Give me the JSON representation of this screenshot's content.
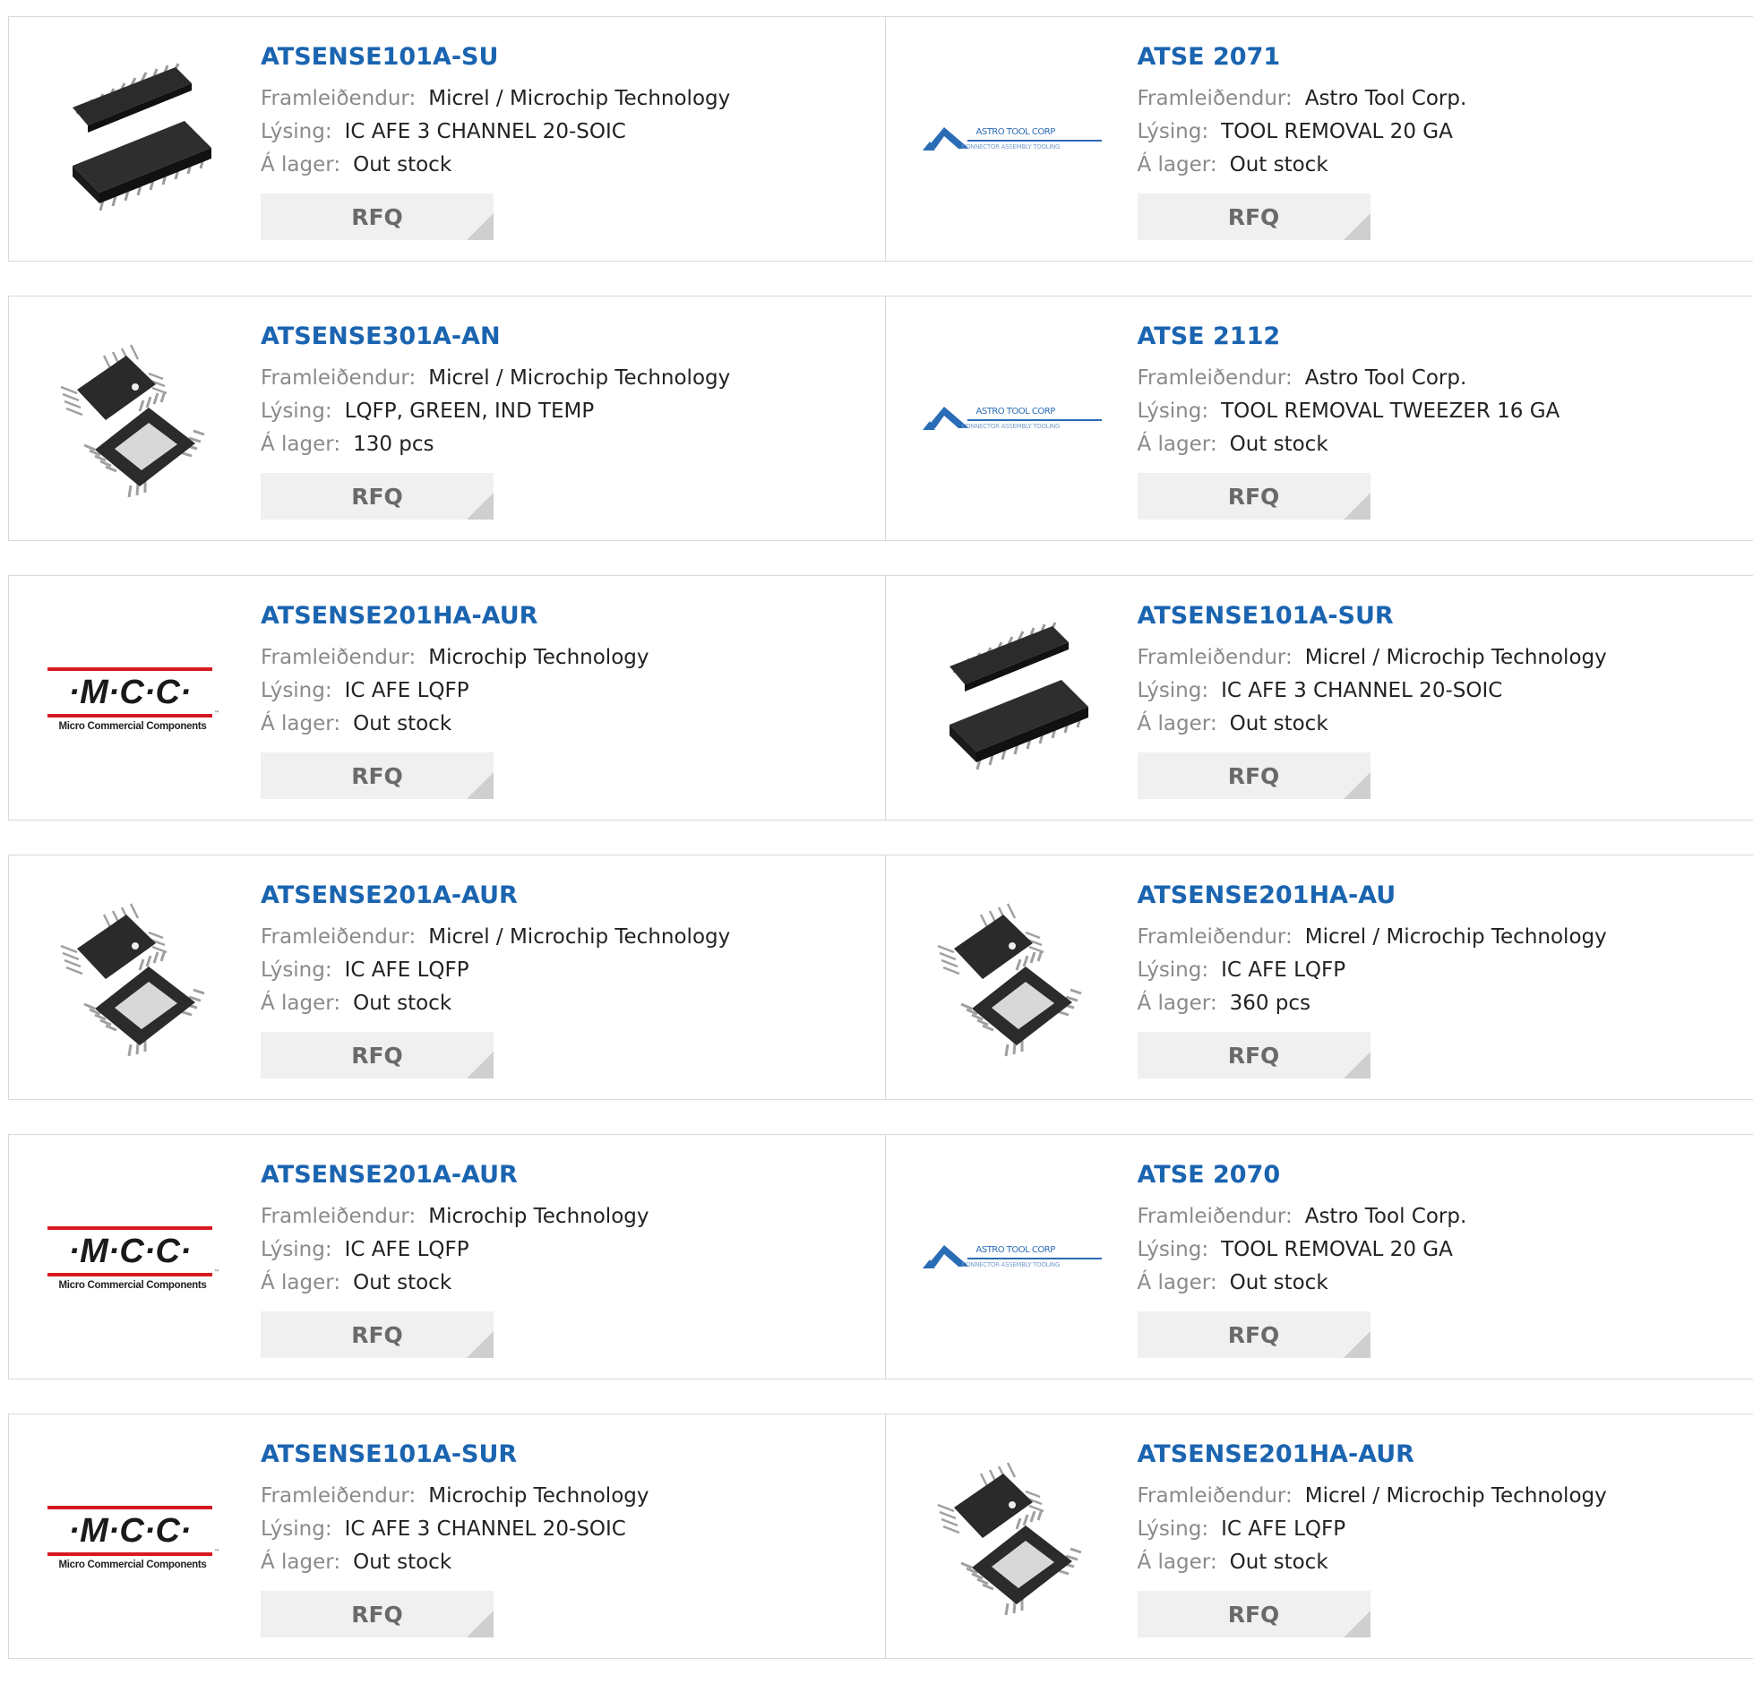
{
  "rows": [
    [
      {
        "part": "ATSENSE101A-SU",
        "image": "soic-chip",
        "manufacturer": "Micrel / Microchip Technology",
        "description": "IC AFE 3 CHANNEL 20-SOIC",
        "stock": "Out stock"
      },
      {
        "part": "ATSE 2071",
        "image": "astro-logo",
        "manufacturer": "Astro Tool Corp.",
        "description": "TOOL REMOVAL 20 GA",
        "stock": "Out stock"
      }
    ],
    [
      {
        "part": "ATSENSE301A-AN",
        "image": "lqfp-chip",
        "manufacturer": "Micrel / Microchip Technology",
        "description": "LQFP, GREEN, IND TEMP",
        "stock": "130 pcs"
      },
      {
        "part": "ATSE 2112",
        "image": "astro-logo",
        "manufacturer": "Astro Tool Corp.",
        "description": "TOOL REMOVAL TWEEZER 16 GA",
        "stock": "Out stock"
      }
    ],
    [
      {
        "part": "ATSENSE201HA-AUR",
        "image": "mcc-logo",
        "manufacturer": "Microchip Technology",
        "description": "IC AFE LQFP",
        "stock": "Out stock"
      },
      {
        "part": "ATSENSE101A-SUR",
        "image": "soic-chip",
        "manufacturer": "Micrel / Microchip Technology",
        "description": "IC AFE 3 CHANNEL 20-SOIC",
        "stock": "Out stock"
      }
    ],
    [
      {
        "part": "ATSENSE201A-AUR",
        "image": "lqfp-chip",
        "manufacturer": "Micrel / Microchip Technology",
        "description": "IC AFE LQFP",
        "stock": "Out stock"
      },
      {
        "part": "ATSENSE201HA-AU",
        "image": "lqfp-chip",
        "manufacturer": "Micrel / Microchip Technology",
        "description": "IC AFE LQFP",
        "stock": "360 pcs"
      }
    ],
    [
      {
        "part": "ATSENSE201A-AUR",
        "image": "mcc-logo",
        "manufacturer": "Microchip Technology",
        "description": "IC AFE LQFP",
        "stock": "Out stock"
      },
      {
        "part": "ATSE 2070",
        "image": "astro-logo",
        "manufacturer": "Astro Tool Corp.",
        "description": "TOOL REMOVAL 20 GA",
        "stock": "Out stock"
      }
    ],
    [
      {
        "part": "ATSENSE101A-SUR",
        "image": "mcc-logo",
        "manufacturer": "Microchip Technology",
        "description": "IC AFE 3 CHANNEL 20-SOIC",
        "stock": "Out stock"
      },
      {
        "part": "ATSENSE201HA-AUR",
        "image": "lqfp-chip",
        "manufacturer": "Micrel / Microchip Technology",
        "description": "IC AFE LQFP",
        "stock": "Out stock"
      }
    ]
  ],
  "labels": {
    "manufacturer": "Framleiðendur:",
    "description": "Lýsing:",
    "stock": "Á lager:",
    "rfq": "RFQ"
  },
  "logos": {
    "astro_name": "ASTRO TOOL CORP",
    "astro_tagline": "CONNECTOR ASSEMBLY TOOLING",
    "mcc_mark": "·M·C·C·",
    "mcc_name": "Micro Commercial Components",
    "mcc_tm": "™"
  },
  "colors": {
    "link": "#1a64b0",
    "label": "#8a8a8a",
    "border": "#d9d9d9",
    "button_bg": "#f0f0f0",
    "mcc_red": "#d71920",
    "astro_blue": "#2a6cb5"
  }
}
